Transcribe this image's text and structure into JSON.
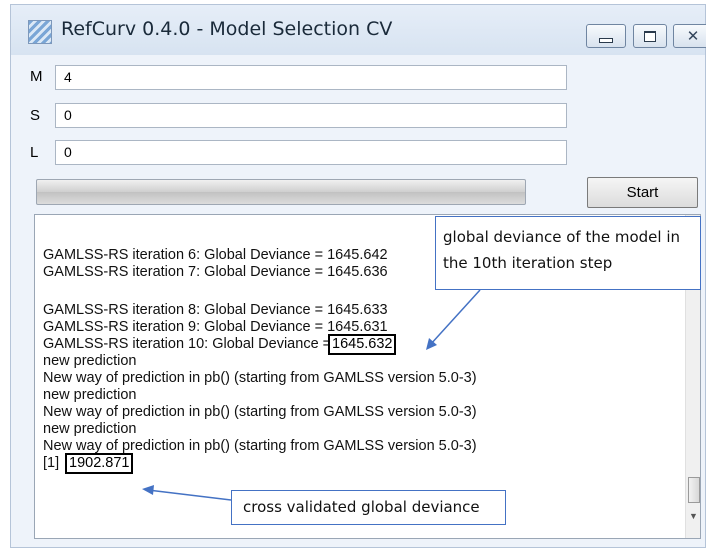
{
  "window": {
    "title": "RefCurv 0.4.0 - Model Selection CV"
  },
  "fields": [
    {
      "label": "M",
      "value": "4"
    },
    {
      "label": "S",
      "value": "0"
    },
    {
      "label": "L",
      "value": "0"
    }
  ],
  "progress": {
    "fraction": 0
  },
  "start_button": {
    "label": "Start"
  },
  "log": {
    "lines": [
      "GAMLSS-RS iteration 6: Global Deviance = 1645.642",
      "GAMLSS-RS iteration 7: Global Deviance = 1645.636",
      "",
      "GAMLSS-RS iteration 8: Global Deviance = 1645.633",
      "GAMLSS-RS iteration 9: Global Deviance = 1645.631",
      "GAMLSS-RS iteration 10: Global Deviance = ",
      "new prediction",
      "New way of prediction in pb()  (starting from GAMLSS version 5.0-3)",
      "new prediction",
      "New way of prediction in pb()  (starting from GAMLSS version 5.0-3)",
      "new prediction",
      "New way of prediction in pb()  (starting from GAMLSS version 5.0-3)",
      "[1] "
    ],
    "highlight_iter10_value": "1645.632",
    "highlight_result_value": "1902.871"
  },
  "annotations": {
    "top_callout": "global deviance of the model in the 10th iteration step",
    "bottom_callout": "cross validated global deviance",
    "color": "#4472c4"
  }
}
